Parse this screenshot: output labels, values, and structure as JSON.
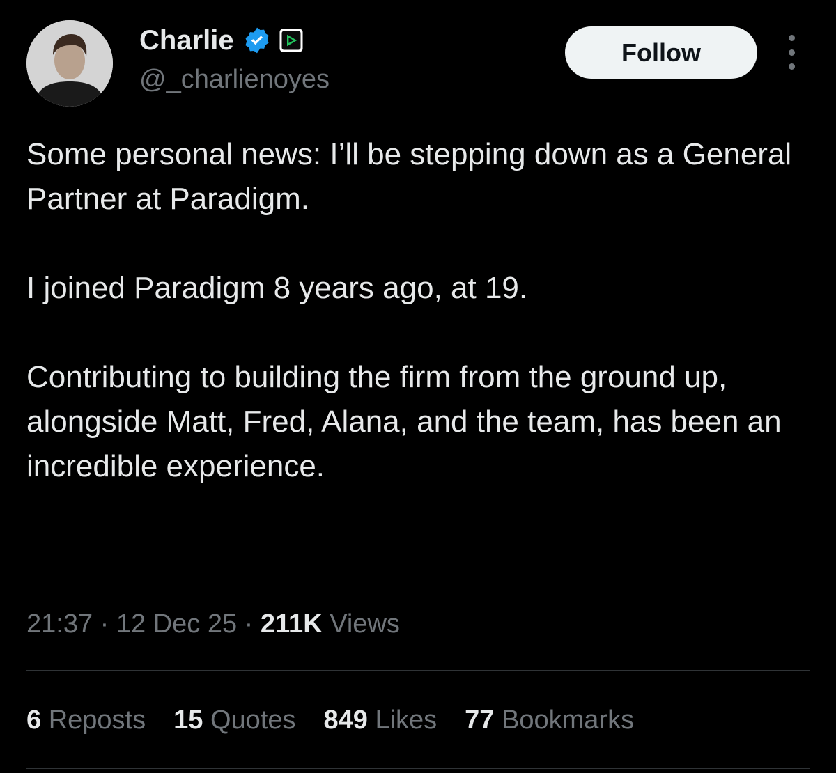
{
  "author": {
    "display_name": "Charlie",
    "handle": "@_charlienoyes",
    "verified_icon": "verified-badge-icon",
    "affiliate_icon": "affiliate-badge-icon"
  },
  "actions": {
    "follow_label": "Follow",
    "more_icon": "more-options-icon"
  },
  "tweet": {
    "paragraphs": [
      "Some personal news: I’ll be stepping down as a General Partner at Paradigm.",
      "I joined Paradigm 8 years ago, at 19.",
      "Contributing to building the firm from the ground up, alongside Matt, Fred, Alana, and the team, has been an incredible experience."
    ]
  },
  "meta": {
    "time": "21:37",
    "date": "12 Dec 25",
    "separator": " · ",
    "views_count": "211K",
    "views_label": "Views"
  },
  "stats": [
    {
      "count": "6",
      "label": "Reposts"
    },
    {
      "count": "15",
      "label": "Quotes"
    },
    {
      "count": "849",
      "label": "Likes"
    },
    {
      "count": "77",
      "label": "Bookmarks"
    }
  ],
  "colors": {
    "background": "#000000",
    "text_primary": "#e7e9ea",
    "text_secondary": "#71767b",
    "verified_blue": "#1d9bf0",
    "follow_bg": "#eff3f4",
    "divider": "#2f3336"
  }
}
